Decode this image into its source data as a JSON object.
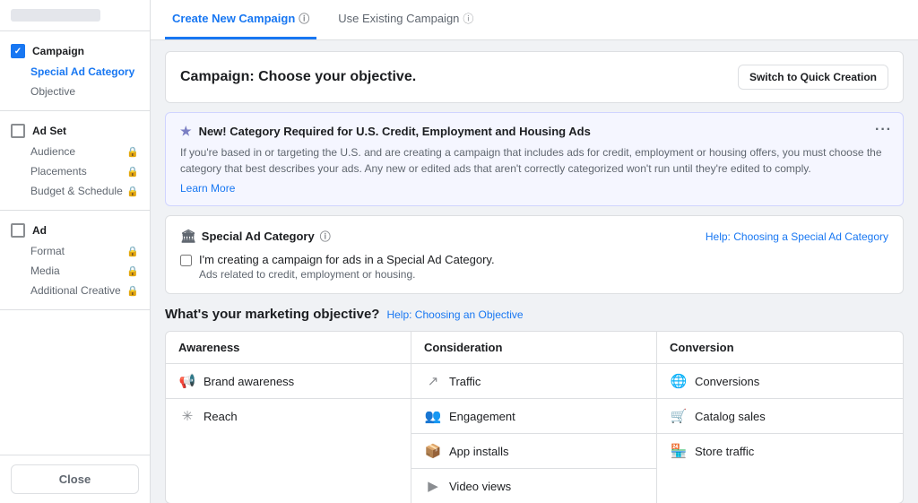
{
  "sidebar": {
    "top_blur": "blurred",
    "sections": [
      {
        "name": "Campaign",
        "type": "checked",
        "items": [
          {
            "label": "Special Ad Category",
            "active": true,
            "locked": false
          },
          {
            "label": "Objective",
            "active": false,
            "locked": false
          }
        ]
      },
      {
        "name": "Ad Set",
        "type": "box",
        "items": [
          {
            "label": "Audience",
            "active": false,
            "locked": true
          },
          {
            "label": "Placements",
            "active": false,
            "locked": true
          },
          {
            "label": "Budget & Schedule",
            "active": false,
            "locked": true
          }
        ]
      },
      {
        "name": "Ad",
        "type": "box",
        "items": [
          {
            "label": "Format",
            "active": false,
            "locked": true
          },
          {
            "label": "Media",
            "active": false,
            "locked": true
          },
          {
            "label": "Additional Creative",
            "active": false,
            "locked": true
          }
        ]
      }
    ],
    "close_label": "Close"
  },
  "tabs": [
    {
      "label": "Create New Campaign",
      "active": true
    },
    {
      "label": "Use Existing Campaign",
      "active": false
    }
  ],
  "campaign_header": {
    "title_prefix": "Campaign",
    "title_suffix": ": Choose your objective.",
    "switch_button": "Switch to Quick Creation"
  },
  "notice": {
    "title": "New! Category Required for U.S. Credit, Employment and Housing Ads",
    "body": "If you're based in or targeting the U.S. and are creating a campaign that includes ads for credit, employment or housing offers, you must choose the category that best describes your ads. Any new or edited ads that aren't correctly categorized won't run until they're edited to comply.",
    "learn_more": "Learn More",
    "more_dots": "···"
  },
  "special_ad_category": {
    "title": "Special Ad Category",
    "help_link": "Help: Choosing a Special Ad Category",
    "checkbox_label": "I'm creating a campaign for ads in a Special Ad Category.",
    "checkbox_sublabel": "Ads related to credit, employment or housing."
  },
  "marketing_objective": {
    "title": "What's your marketing objective?",
    "help_link": "Help: Choosing an Objective",
    "columns": [
      {
        "header": "Awareness",
        "items": [
          {
            "icon": "📢",
            "label": "Brand awareness"
          },
          {
            "icon": "✳",
            "label": "Reach"
          }
        ]
      },
      {
        "header": "Consideration",
        "items": [
          {
            "icon": "↗",
            "label": "Traffic"
          },
          {
            "icon": "👥",
            "label": "Engagement"
          },
          {
            "icon": "📦",
            "label": "App installs"
          },
          {
            "icon": "▶",
            "label": "Video views"
          }
        ]
      },
      {
        "header": "Conversion",
        "items": [
          {
            "icon": "🌐",
            "label": "Conversions"
          },
          {
            "icon": "🛒",
            "label": "Catalog sales"
          },
          {
            "icon": "🏪",
            "label": "Store traffic"
          }
        ]
      }
    ]
  },
  "icons": {
    "info": "ⓘ",
    "lock": "🔒",
    "star": "★",
    "building": "🏛",
    "checkbox": "☐"
  }
}
